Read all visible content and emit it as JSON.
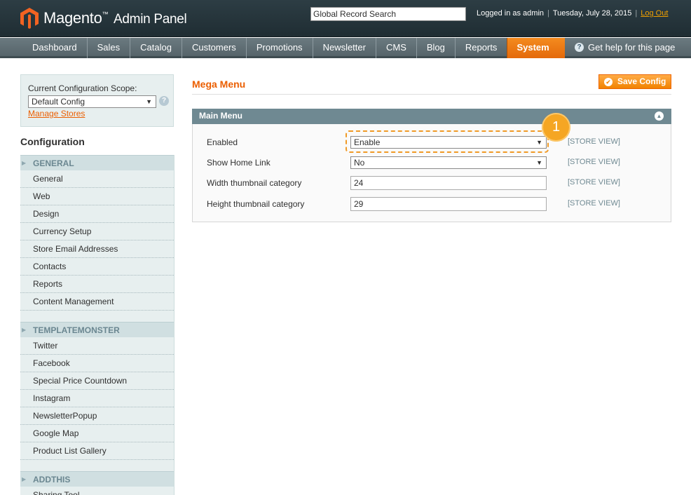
{
  "header": {
    "app_name": "Magento",
    "trademark": "™",
    "panel_name": "Admin Panel",
    "search_value": "Global Record Search",
    "logged_in": "Logged in as admin",
    "date": "Tuesday, July 28, 2015",
    "logout": "Log Out"
  },
  "nav": {
    "items": [
      "Dashboard",
      "Sales",
      "Catalog",
      "Customers",
      "Promotions",
      "Newsletter",
      "CMS",
      "Blog",
      "Reports",
      "System"
    ],
    "active": "System",
    "help": "Get help for this page"
  },
  "scope": {
    "label": "Current Configuration Scope:",
    "value": "Default Config",
    "manage_stores": "Manage Stores"
  },
  "sidebar": {
    "title": "Configuration",
    "groups": [
      {
        "title": "GENERAL",
        "items": [
          "General",
          "Web",
          "Design",
          "Currency Setup",
          "Store Email Addresses",
          "Contacts",
          "Reports",
          "Content Management"
        ]
      },
      {
        "title": "TEMPLATEMONSTER",
        "items": [
          "Twitter",
          "Facebook",
          "Special Price Countdown",
          "Instagram",
          "NewsletterPopup",
          "Google Map",
          "Product List Gallery"
        ]
      },
      {
        "title": "ADDTHIS",
        "items": [
          "Sharing Tool"
        ]
      }
    ]
  },
  "main": {
    "title": "Mega Menu",
    "save_label": "Save Config",
    "fieldset_title": "Main Menu",
    "fields": [
      {
        "label": "Enabled",
        "value": "Enable",
        "scope": "[STORE VIEW]"
      },
      {
        "label": "Show Home Link",
        "value": "No",
        "scope": "[STORE VIEW]"
      },
      {
        "label": "Width thumbnail category",
        "value": "24",
        "scope": "[STORE VIEW]"
      },
      {
        "label": "Height thumbnail category",
        "value": "29",
        "scope": "[STORE VIEW]"
      }
    ],
    "callout_number": "1"
  },
  "colors": {
    "accent": "#eb5e00",
    "header_bg": "#2d3d44",
    "nav_active": "#f48b1f",
    "badge": "#f5a623"
  }
}
